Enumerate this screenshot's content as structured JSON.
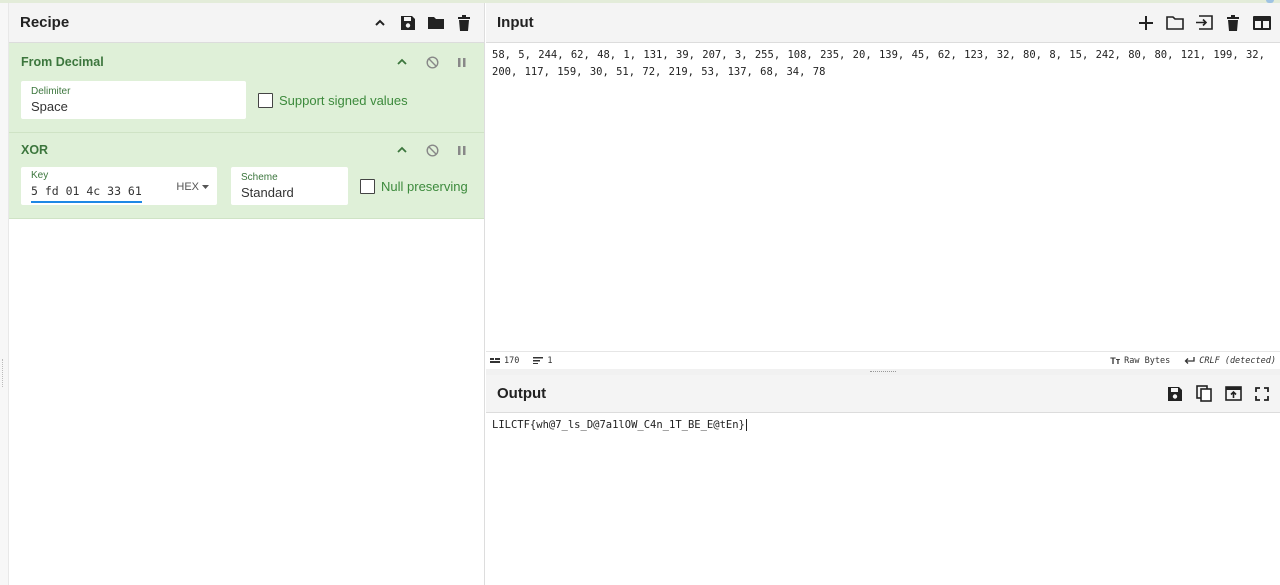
{
  "recipe": {
    "title": "Recipe",
    "operations": [
      {
        "name": "From Decimal",
        "delimiter_label": "Delimiter",
        "delimiter_value": "Space",
        "checkbox_label": "Support signed values",
        "checked": false
      },
      {
        "name": "XOR",
        "key_label": "Key",
        "key_value": "5 fd 01 4c 33 61",
        "key_format": "HEX",
        "scheme_label": "Scheme",
        "scheme_value": "Standard",
        "checkbox_label": "Null preserving",
        "checked": false
      }
    ]
  },
  "input": {
    "title": "Input",
    "text": "58, 5, 244, 62, 48, 1, 131, 39, 207, 3, 255, 108, 235, 20, 139, 45, 62, 123, 32, 80, 8, 15, 242, 80, 80, 121, 199, 32, 200, 117, 159, 30, 51, 72, 219, 53, 137, 68, 34, 78",
    "status": {
      "length": "170",
      "lines": "1",
      "encoding": "Raw Bytes",
      "eol": "CRLF (detected)"
    }
  },
  "output": {
    "title": "Output",
    "text": "LILCTF{wh@7_ls_D@7a1lOW_C4n_1T_BE_E@tEn}"
  },
  "colors": {
    "op_bg": "#dff0d8",
    "op_text": "#3c763d",
    "accent_blue": "#1e88e5"
  }
}
